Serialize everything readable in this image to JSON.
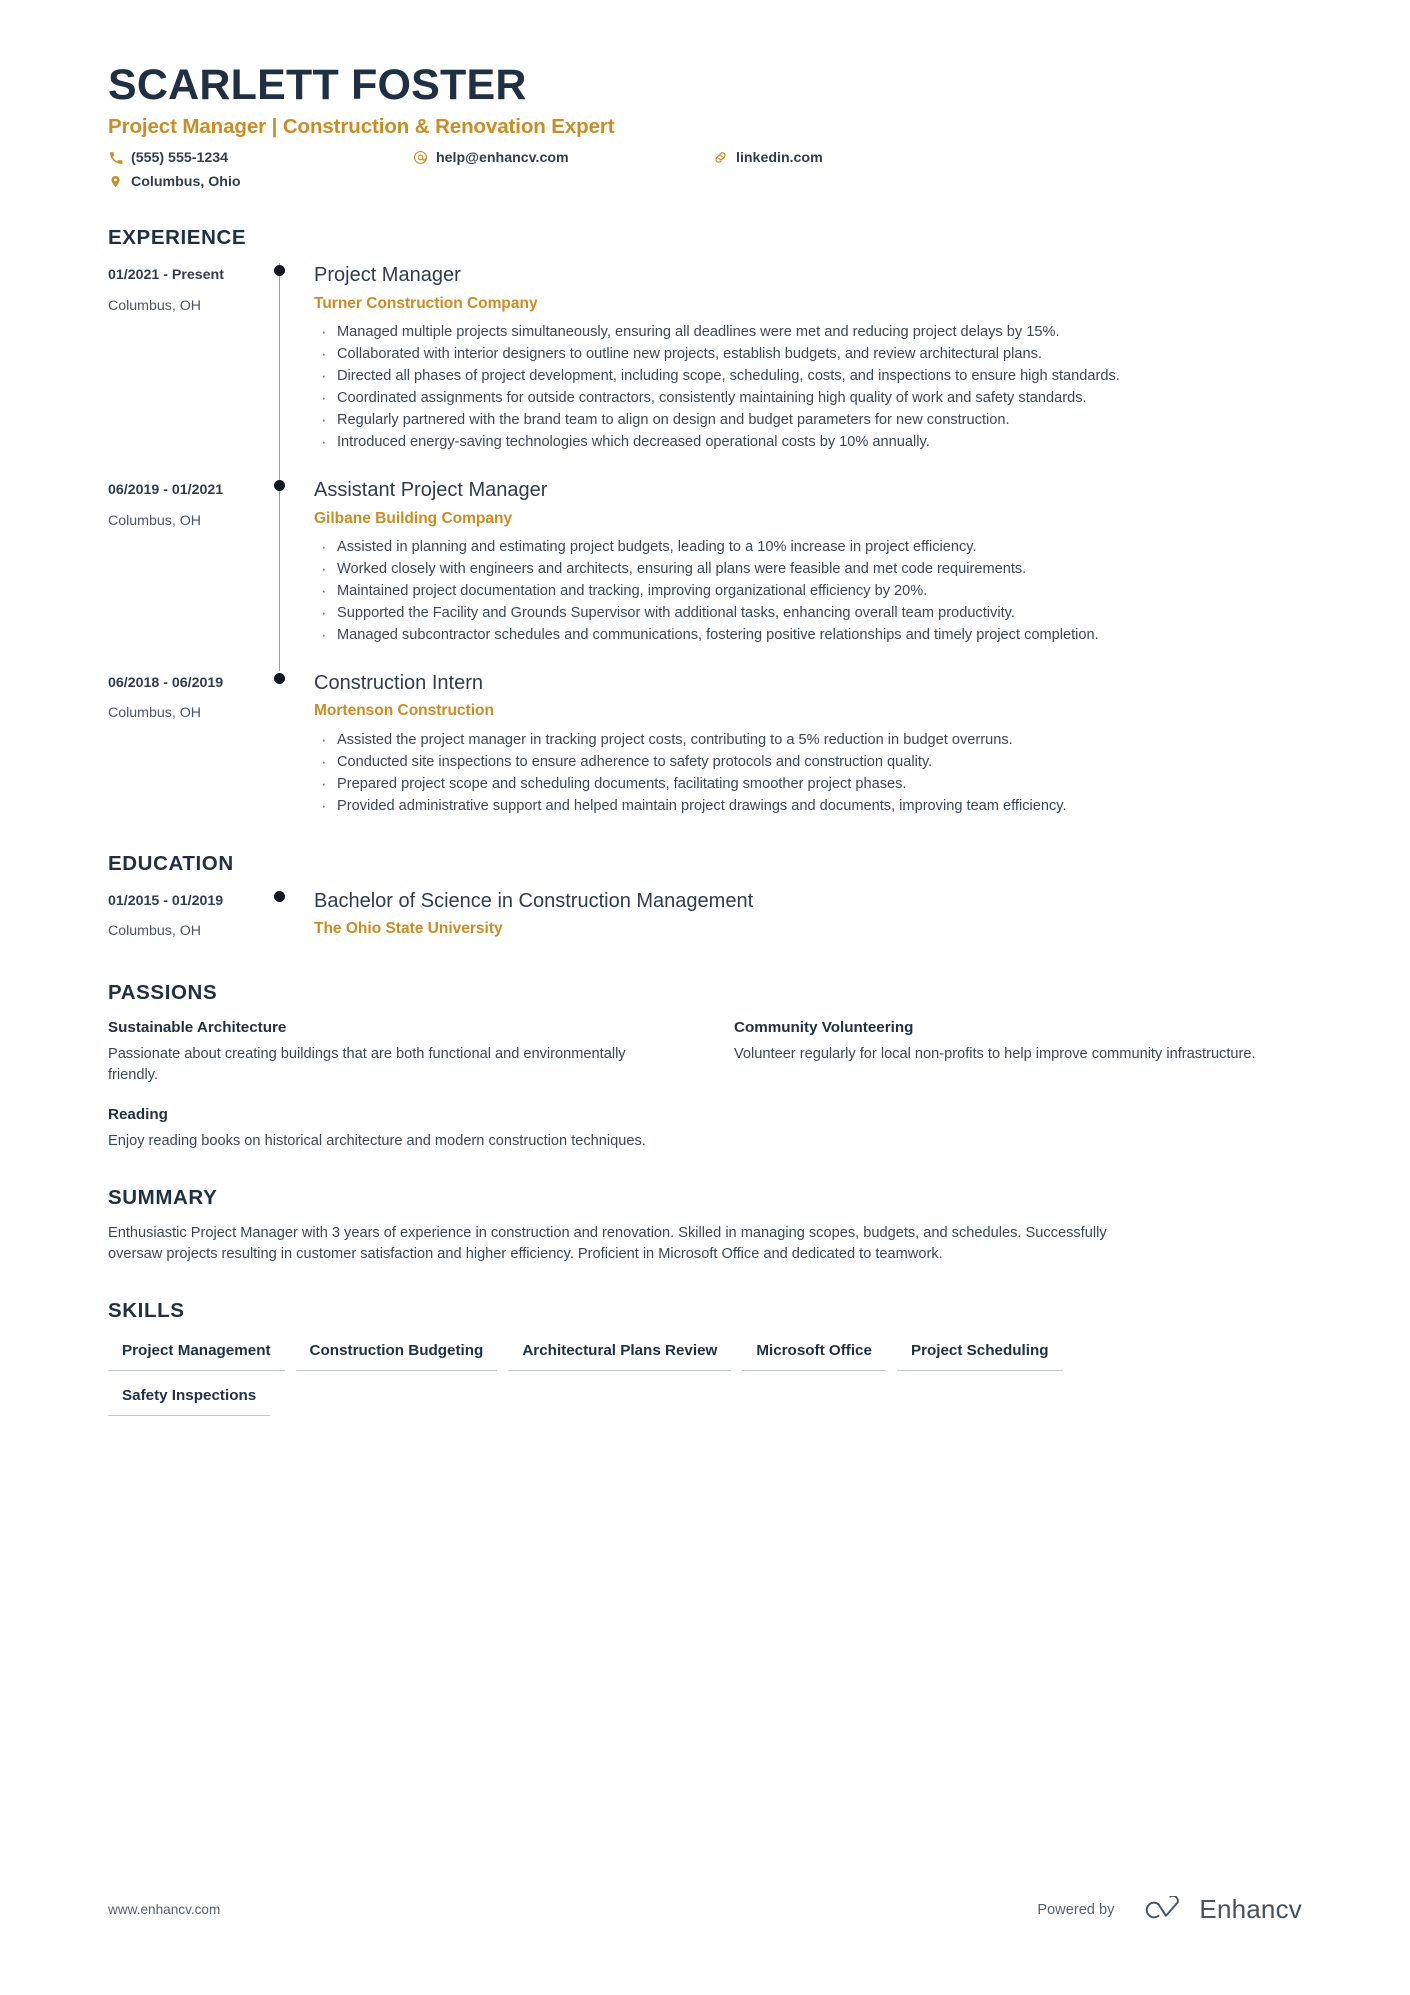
{
  "header": {
    "full_name": "SCARLETT FOSTER",
    "headline": "Project Manager | Construction & Renovation Expert",
    "accent_color": "#cc8c24",
    "name_color": "#1f3043",
    "contacts": [
      {
        "icon": "phone-icon",
        "value": "(555) 555-1234"
      },
      {
        "icon": "email-icon",
        "value": "help@enhancv.com"
      },
      {
        "icon": "link-icon",
        "value": "linkedin.com"
      },
      {
        "icon": "location-pin-icon",
        "value": "Columbus, Ohio"
      }
    ]
  },
  "sections": {
    "experience": {
      "title": "EXPERIENCE",
      "entries": [
        {
          "date": "01/2021 - Present",
          "location": "Columbus, OH",
          "title": "Project Manager",
          "organization": "Turner Construction Company",
          "bullets": [
            "Managed multiple projects simultaneously, ensuring all deadlines were met and reducing project delays by 15%.",
            "Collaborated with interior designers to outline new projects, establish budgets, and review architectural plans.",
            "Directed all phases of project development, including scope, scheduling, costs, and inspections to ensure high standards.",
            "Coordinated assignments for outside contractors, consistently maintaining high quality of work and safety standards.",
            "Regularly partnered with the brand team to align on design and budget parameters for new construction.",
            "Introduced energy-saving technologies which decreased operational costs by 10% annually."
          ]
        },
        {
          "date": "06/2019 - 01/2021",
          "location": "Columbus, OH",
          "title": "Assistant Project Manager",
          "organization": "Gilbane Building Company",
          "bullets": [
            "Assisted in planning and estimating project budgets, leading to a 10% increase in project efficiency.",
            "Worked closely with engineers and architects, ensuring all plans were feasible and met code requirements.",
            "Maintained project documentation and tracking, improving organizational efficiency by 20%.",
            "Supported the Facility and Grounds Supervisor with additional tasks, enhancing overall team productivity.",
            "Managed subcontractor schedules and communications, fostering positive relationships and timely project completion."
          ]
        },
        {
          "date": "06/2018 - 06/2019",
          "location": "Columbus, OH",
          "title": "Construction Intern",
          "organization": "Mortenson Construction",
          "bullets": [
            "Assisted the project manager in tracking project costs, contributing to a 5% reduction in budget overruns.",
            "Conducted site inspections to ensure adherence to safety protocols and construction quality.",
            "Prepared project scope and scheduling documents, facilitating smoother project phases.",
            "Provided administrative support and helped maintain project drawings and documents, improving team efficiency."
          ]
        }
      ]
    },
    "education": {
      "title": "EDUCATION",
      "entries": [
        {
          "date": "01/2015 - 01/2019",
          "location": "Columbus, OH",
          "title": "Bachelor of Science in Construction Management",
          "organization": "The Ohio State University",
          "bullets": []
        }
      ]
    },
    "passions": {
      "title": "PASSIONS",
      "items": [
        {
          "name": "Sustainable Architecture",
          "description": "Passionate about creating buildings that are both functional and environmentally friendly."
        },
        {
          "name": "Community Volunteering",
          "description": "Volunteer regularly for local non-profits to help improve community infrastructure."
        },
        {
          "name": "Reading",
          "description": "Enjoy reading books on historical architecture and modern construction techniques."
        }
      ]
    },
    "summary": {
      "title": "SUMMARY",
      "text": "Enthusiastic Project Manager with 3 years of experience in construction and renovation. Skilled in managing scopes, budgets, and schedules. Successfully oversaw projects resulting in customer satisfaction and higher efficiency. Proficient in Microsoft Office and dedicated to teamwork."
    },
    "skills": {
      "title": "SKILLS",
      "items": [
        "Project Management",
        "Construction Budgeting",
        "Architectural Plans Review",
        "Microsoft Office",
        "Project Scheduling",
        "Safety Inspections"
      ]
    }
  },
  "footer": {
    "url": "www.enhancv.com",
    "powered_by": "Powered by",
    "brand_name": "Enhancv"
  }
}
